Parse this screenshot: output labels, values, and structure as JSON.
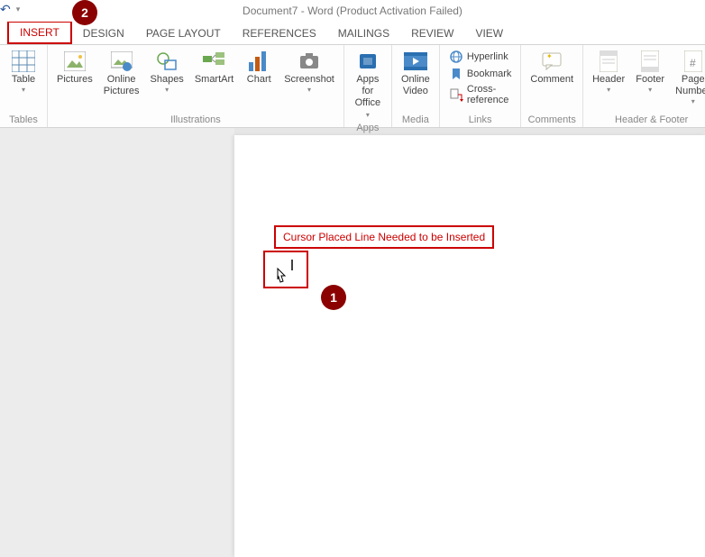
{
  "window": {
    "title": "Document7 - Word (Product Activation Failed)"
  },
  "tabs": {
    "insert": "INSERT",
    "design": "DESIGN",
    "page_layout": "PAGE LAYOUT",
    "references": "REFERENCES",
    "mailings": "MAILINGS",
    "review": "REVIEW",
    "view": "VIEW"
  },
  "ribbon": {
    "table": "Table",
    "pictures": "Pictures",
    "online_pictures_l1": "Online",
    "online_pictures_l2": "Pictures",
    "shapes": "Shapes",
    "smartart": "SmartArt",
    "chart": "Chart",
    "screenshot": "Screenshot",
    "apps_for_l1": "Apps for",
    "apps_for_l2": "Office",
    "online_video_l1": "Online",
    "online_video_l2": "Video",
    "hyperlink": "Hyperlink",
    "bookmark": "Bookmark",
    "cross_reference": "Cross-reference",
    "comment": "Comment",
    "header": "Header",
    "footer": "Footer",
    "page_number_l1": "Page",
    "page_number_l2": "Number"
  },
  "groups": {
    "tables": "Tables",
    "illustrations": "Illustrations",
    "apps": "Apps",
    "media": "Media",
    "links": "Links",
    "comments": "Comments",
    "header_footer": "Header & Footer"
  },
  "annotations": {
    "cursor_text": "Cursor Placed Line Needed to be Inserted",
    "badge1": "1",
    "badge2": "2"
  }
}
